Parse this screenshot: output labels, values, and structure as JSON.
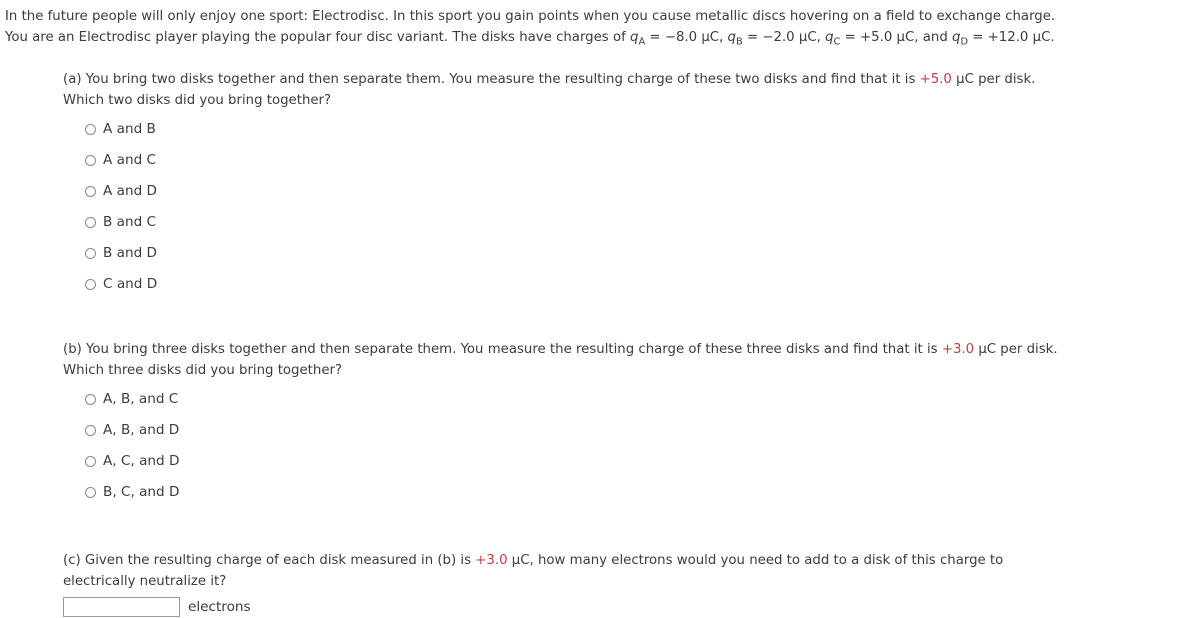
{
  "intro": {
    "line1": "In the future people will only enjoy one sport: Electrodisc. In this sport you gain points when you cause metallic discs hovering on a field to exchange charge.",
    "line2_prefix": "You are an Electrodisc player playing the popular four disc variant. The disks have charges of ",
    "charges": [
      {
        "var": "q",
        "sub": "A",
        "eq": " = ",
        "value": "−8.0 µC",
        "sep": ", "
      },
      {
        "var": "q",
        "sub": "B",
        "eq": " = ",
        "value": "−2.0 µC",
        "sep": ", "
      },
      {
        "var": "q",
        "sub": "C",
        "eq": " = ",
        "value": "+5.0 µC",
        "sep": ", and "
      },
      {
        "var": "q",
        "sub": "D",
        "eq": " = ",
        "value": "+12.0 µC",
        "sep": "."
      }
    ]
  },
  "part_a": {
    "label": "(a)",
    "line1_before": "(a) You bring two disks together and then separate them. You measure the resulting charge of these two disks and find that it is ",
    "line1_highlight": "+5.0",
    "line1_after": " µC  per disk.",
    "line2": "Which two disks did you bring together?",
    "options": [
      {
        "label": "A and B",
        "selected": false
      },
      {
        "label": "A and C",
        "selected": false
      },
      {
        "label": "A and D",
        "selected": false
      },
      {
        "label": "B and C",
        "selected": false
      },
      {
        "label": "B and D",
        "selected": false
      },
      {
        "label": "C and D",
        "selected": false
      }
    ]
  },
  "part_b": {
    "label": "(b)",
    "line1_before": "(b) You bring three disks together and then separate them. You measure the resulting charge of these three disks and find that it is ",
    "line1_highlight": "+3.0",
    "line1_after": " µC  per disk.",
    "line2": "Which three disks did you bring together?",
    "options": [
      {
        "label": "A, B, and C",
        "selected": false
      },
      {
        "label": "A, B, and D",
        "selected": false
      },
      {
        "label": "A, C, and D",
        "selected": false
      },
      {
        "label": "B, C, and D",
        "selected": false
      }
    ]
  },
  "part_c": {
    "label": "(c)",
    "line1_before": "(c) Given the resulting charge of each disk measured in (b) is ",
    "line1_highlight": "+3.0",
    "line1_after": " µC,  how many electrons would you need to add to a disk of this charge to",
    "line2": "electrically neutralize it?",
    "input_value": "",
    "input_placeholder": "",
    "unit_label": "electrons"
  },
  "colors": {
    "text": "#3c3c3c",
    "highlight_red": "#cf3a3f",
    "radio_border": "#8a8a8a",
    "input_border": "#9a9a9a",
    "background": "#ffffff"
  }
}
